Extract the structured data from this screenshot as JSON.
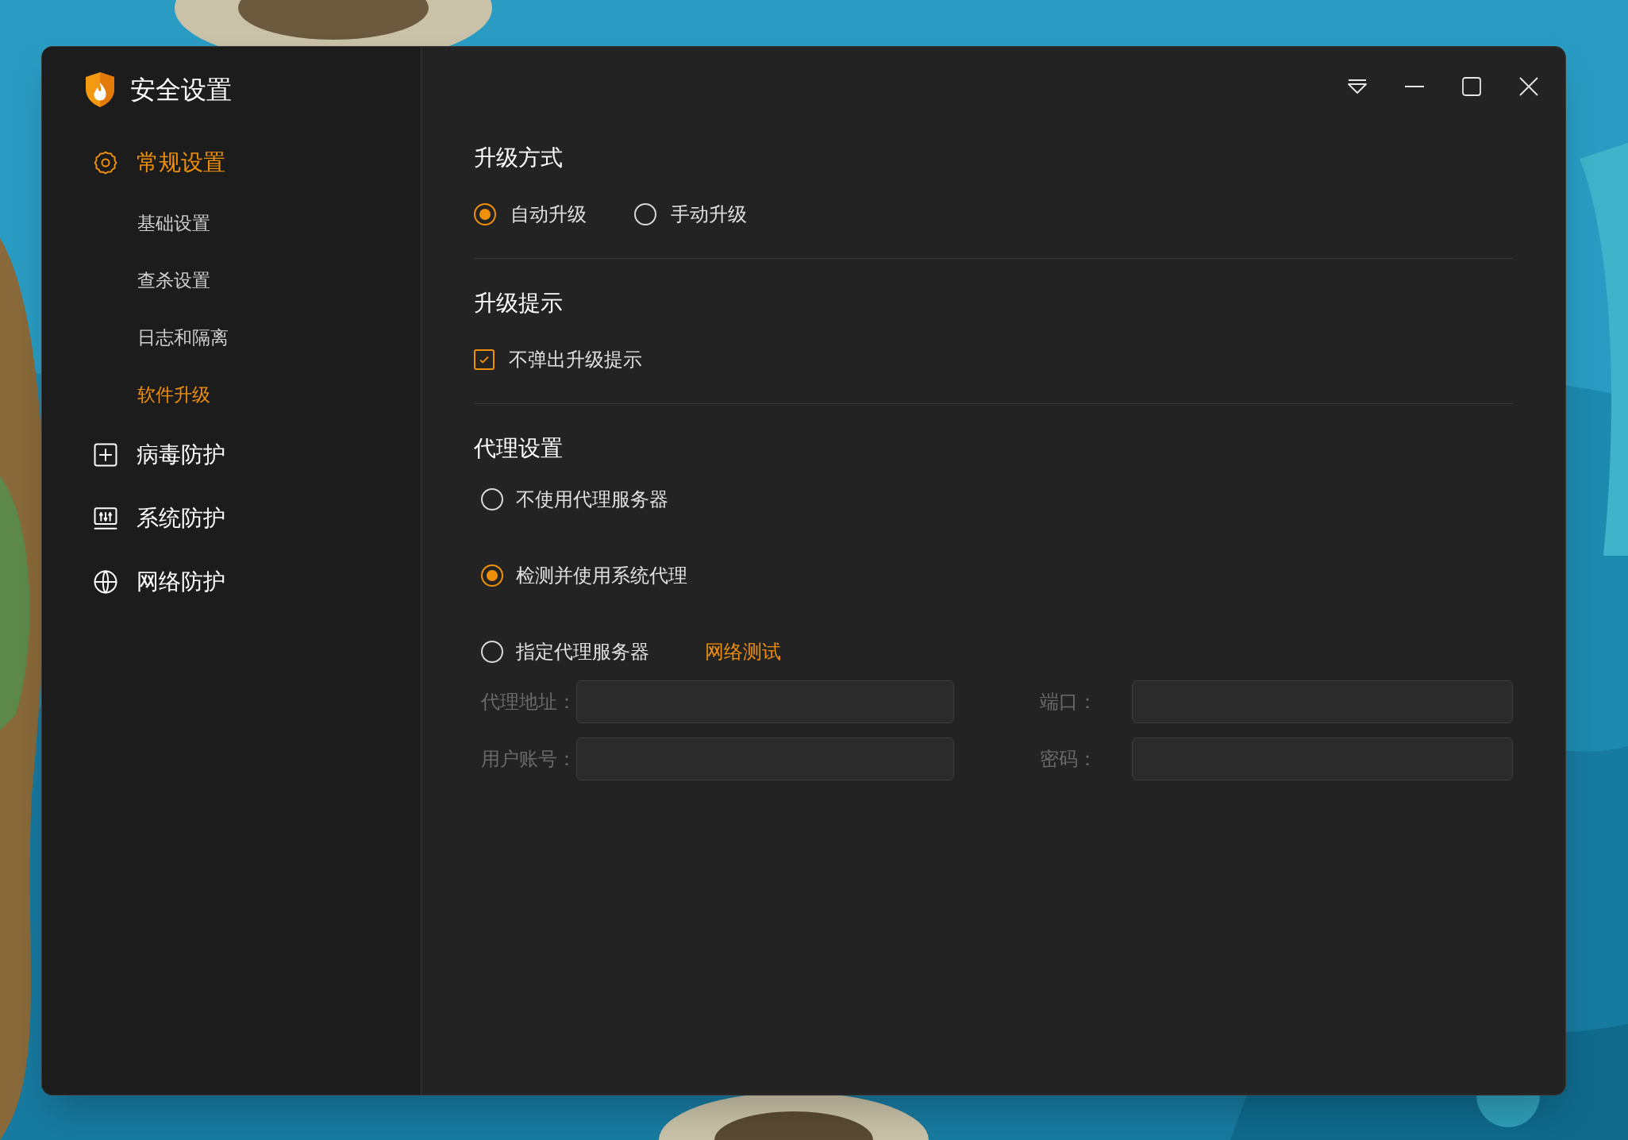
{
  "window": {
    "title": "安全设置"
  },
  "sidebar": {
    "items": [
      {
        "label": "常规设置",
        "kind": "gear",
        "selected": true,
        "children": [
          {
            "label": "基础设置",
            "selected": false
          },
          {
            "label": "查杀设置",
            "selected": false
          },
          {
            "label": "日志和隔离",
            "selected": false
          },
          {
            "label": "软件升级",
            "selected": true
          }
        ]
      },
      {
        "label": "病毒防护",
        "kind": "plus",
        "selected": false
      },
      {
        "label": "系统防护",
        "kind": "sliders",
        "selected": false
      },
      {
        "label": "网络防护",
        "kind": "globe",
        "selected": false
      }
    ]
  },
  "sections": [
    {
      "title": "升级方式",
      "kind": "radio-row",
      "options": [
        {
          "label": "自动升级",
          "selected": true
        },
        {
          "label": "手动升级",
          "selected": false
        }
      ]
    },
    {
      "title": "升级提示",
      "kind": "checkbox",
      "options": [
        {
          "label": "不弹出升级提示",
          "checked": true
        }
      ]
    },
    {
      "title": "代理设置",
      "kind": "radio-list",
      "options": [
        {
          "label": "不使用代理服务器",
          "selected": false
        },
        {
          "label": "检测并使用系统代理",
          "selected": true
        },
        {
          "label": "指定代理服务器",
          "selected": false,
          "link": "网络测试"
        }
      ],
      "fields": [
        {
          "label": "代理地址：",
          "disabled": true
        },
        {
          "label": "端口：",
          "disabled": true
        },
        {
          "label": "用户账号：",
          "disabled": true
        },
        {
          "label": "密码：",
          "disabled": true
        }
      ]
    }
  ]
}
